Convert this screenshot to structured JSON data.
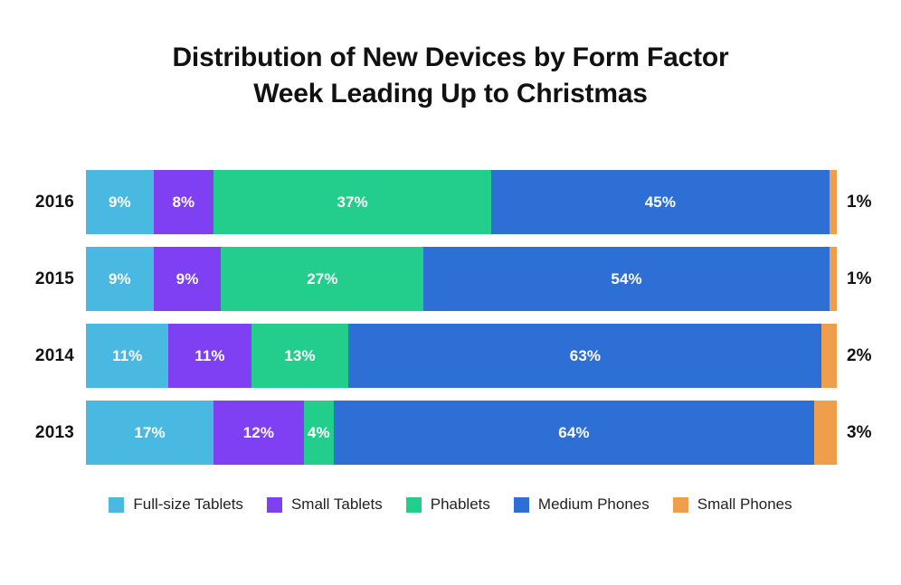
{
  "chart_data": {
    "type": "bar",
    "subtype": "stacked-horizontal-100",
    "title": "Distribution of New Devices by Form Factor",
    "subtitle": "Week Leading Up to Christmas",
    "title_lines": [
      "Distribution of New Devices by Form Factor",
      "Week Leading Up to Christmas"
    ],
    "orientation": "horizontal",
    "stacked": true,
    "categories": [
      "2016",
      "2015",
      "2014",
      "2013"
    ],
    "xlabel": "",
    "ylabel": "",
    "xlim": [
      0,
      100
    ],
    "grid": false,
    "axis_visible": false,
    "value_suffix": "%",
    "legend_position": "bottom",
    "series": [
      {
        "name": "Full-size Tablets",
        "color": "#4ab9e2",
        "values": [
          9,
          9,
          11,
          17
        ],
        "labels": [
          "9%",
          "9%",
          "11%",
          "17%"
        ],
        "label_position": "inside"
      },
      {
        "name": "Small Tablets",
        "color": "#7f3ff2",
        "values": [
          8,
          9,
          11,
          12
        ],
        "labels": [
          "8%",
          "9%",
          "11%",
          "12%"
        ],
        "label_position": "inside"
      },
      {
        "name": "Phablets",
        "color": "#23ce8c",
        "values": [
          37,
          27,
          13,
          4
        ],
        "labels": [
          "37%",
          "27%",
          "13%",
          "4%"
        ],
        "label_position": "inside"
      },
      {
        "name": "Medium Phones",
        "color": "#2d6fd4",
        "values": [
          45,
          54,
          63,
          64
        ],
        "labels": [
          "45%",
          "54%",
          "63%",
          "64%"
        ],
        "label_position": "inside"
      },
      {
        "name": "Small Phones",
        "color": "#ef9f4b",
        "values": [
          1,
          1,
          2,
          3
        ],
        "labels": [
          "1%",
          "1%",
          "2%",
          "3%"
        ],
        "label_position": "outside"
      }
    ]
  },
  "rows": [
    {
      "year": "2016",
      "outside_label": "1%",
      "segments": [
        {
          "label": "9%",
          "value": 9,
          "color": "#4ab9e2",
          "series": "Full-size Tablets",
          "show_label": true
        },
        {
          "label": "8%",
          "value": 8,
          "color": "#7f3ff2",
          "series": "Small Tablets",
          "show_label": true
        },
        {
          "label": "37%",
          "value": 37,
          "color": "#23ce8c",
          "series": "Phablets",
          "show_label": true
        },
        {
          "label": "45%",
          "value": 45,
          "color": "#2d6fd4",
          "series": "Medium Phones",
          "show_label": true
        },
        {
          "label": "1%",
          "value": 1,
          "color": "#ef9f4b",
          "series": "Small Phones",
          "show_label": false
        }
      ]
    },
    {
      "year": "2015",
      "outside_label": "1%",
      "segments": [
        {
          "label": "9%",
          "value": 9,
          "color": "#4ab9e2",
          "series": "Full-size Tablets",
          "show_label": true
        },
        {
          "label": "9%",
          "value": 9,
          "color": "#7f3ff2",
          "series": "Small Tablets",
          "show_label": true
        },
        {
          "label": "27%",
          "value": 27,
          "color": "#23ce8c",
          "series": "Phablets",
          "show_label": true
        },
        {
          "label": "54%",
          "value": 54,
          "color": "#2d6fd4",
          "series": "Medium Phones",
          "show_label": true
        },
        {
          "label": "1%",
          "value": 1,
          "color": "#ef9f4b",
          "series": "Small Phones",
          "show_label": false
        }
      ]
    },
    {
      "year": "2014",
      "outside_label": "2%",
      "segments": [
        {
          "label": "11%",
          "value": 11,
          "color": "#4ab9e2",
          "series": "Full-size Tablets",
          "show_label": true
        },
        {
          "label": "11%",
          "value": 11,
          "color": "#7f3ff2",
          "series": "Small Tablets",
          "show_label": true
        },
        {
          "label": "13%",
          "value": 13,
          "color": "#23ce8c",
          "series": "Phablets",
          "show_label": true
        },
        {
          "label": "63%",
          "value": 63,
          "color": "#2d6fd4",
          "series": "Medium Phones",
          "show_label": true
        },
        {
          "label": "2%",
          "value": 2,
          "color": "#ef9f4b",
          "series": "Small Phones",
          "show_label": false
        }
      ]
    },
    {
      "year": "2013",
      "outside_label": "3%",
      "segments": [
        {
          "label": "17%",
          "value": 17,
          "color": "#4ab9e2",
          "series": "Full-size Tablets",
          "show_label": true
        },
        {
          "label": "12%",
          "value": 12,
          "color": "#7f3ff2",
          "series": "Small Tablets",
          "show_label": true
        },
        {
          "label": "4%",
          "value": 4,
          "color": "#23ce8c",
          "series": "Phablets",
          "show_label": true
        },
        {
          "label": "64%",
          "value": 64,
          "color": "#2d6fd4",
          "series": "Medium Phones",
          "show_label": true
        },
        {
          "label": "3%",
          "value": 3,
          "color": "#ef9f4b",
          "series": "Small Phones",
          "show_label": false
        }
      ]
    }
  ],
  "legend": {
    "items": [
      {
        "label": "Full-size Tablets",
        "color": "#4ab9e2"
      },
      {
        "label": "Small Tablets",
        "color": "#7f3ff2"
      },
      {
        "label": "Phablets",
        "color": "#23ce8c"
      },
      {
        "label": "Medium Phones",
        "color": "#2d6fd4"
      },
      {
        "label": "Small Phones",
        "color": "#ef9f4b"
      }
    ]
  }
}
